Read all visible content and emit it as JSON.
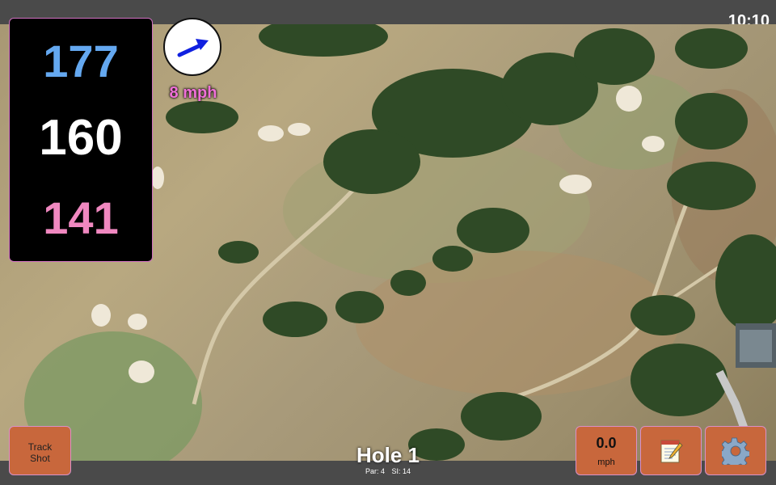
{
  "status_bar": {
    "time": "10:10"
  },
  "distances": {
    "back": "177",
    "middle": "160",
    "front": "141"
  },
  "wind": {
    "speed_label": "8 mph",
    "direction_icon": "wind-arrow-icon"
  },
  "buttons": {
    "track_shot_line1": "Track",
    "track_shot_line2": "Shot",
    "speed_value": "0.0",
    "speed_unit": "mph",
    "notes_icon": "notepad-icon",
    "settings_icon": "gear-icon"
  },
  "hole": {
    "title": "Hole 1",
    "par_label": "Par: 4",
    "si_label": "SI: 14"
  },
  "colors": {
    "back": "#64a8f0",
    "middle": "#ffffff",
    "front": "#f088c0",
    "wind": "#f070d8",
    "button": "#c8673c"
  }
}
